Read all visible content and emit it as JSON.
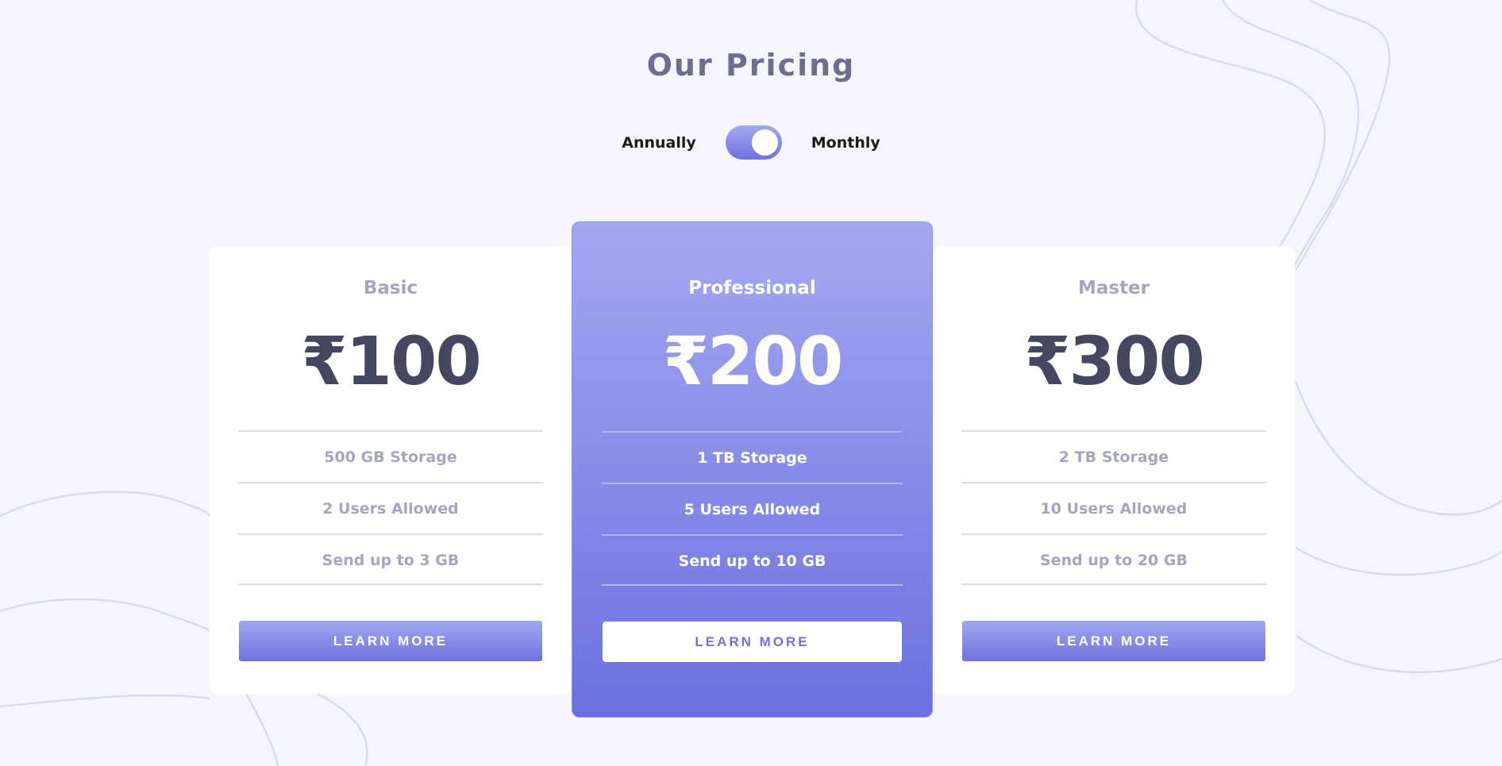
{
  "header": {
    "title": "Our Pricing"
  },
  "billing_toggle": {
    "left_label": "Annually",
    "right_label": "Monthly",
    "selected": "Monthly"
  },
  "plans": [
    {
      "name": "Basic",
      "price": "₹100",
      "features": [
        "500 GB Storage",
        "2 Users Allowed",
        "Send up to 3 GB"
      ],
      "cta": "Learn More"
    },
    {
      "name": "Professional",
      "price": "₹200",
      "features": [
        "1 TB Storage",
        "5 Users Allowed",
        "Send up to 10 GB"
      ],
      "cta": "Learn More"
    },
    {
      "name": "Master",
      "price": "₹300",
      "features": [
        "2 TB Storage",
        "10 Users Allowed",
        "Send up to 20 GB"
      ],
      "cta": "Learn More"
    }
  ],
  "colors": {
    "background": "#f5f6fd",
    "accent_start": "#a3a8f0",
    "accent_end": "#6f72dd",
    "heading": "#6d6e8c",
    "price": "#454760",
    "muted": "#a4a6bf"
  }
}
